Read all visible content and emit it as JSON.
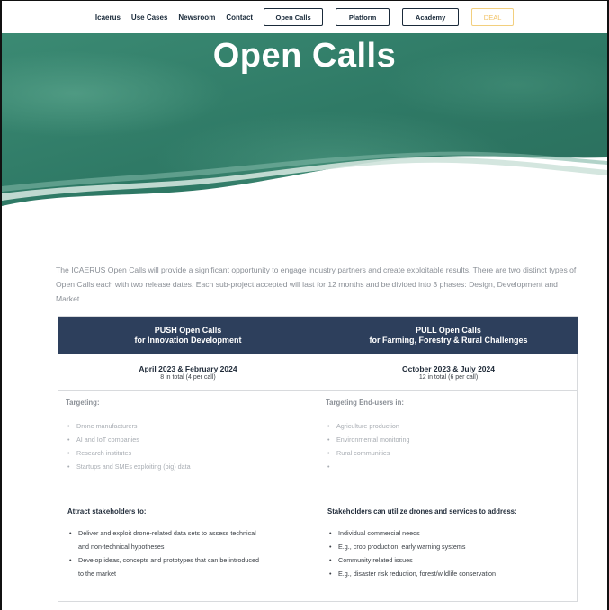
{
  "nav": {
    "links": [
      "Icaerus",
      "Use Cases",
      "Newsroom",
      "Contact"
    ],
    "buttons": {
      "open_calls": "Open Calls",
      "platform": "Platform",
      "academy": "Academy",
      "deal": "DEAL"
    }
  },
  "colors": {
    "hero_teal": "#2f7a66",
    "header_navy": "#2d3f5c",
    "deal_accent": "#f2c265"
  },
  "hero": {
    "title": "Open Calls"
  },
  "intro": {
    "text": "The ICAERUS Open Calls will provide a significant opportunity to engage industry partners and create exploitable results. There are two distinct types of Open Calls each with two release dates. Each sub-project accepted will last for 12 months and be divided into 3 phases: Design, Development and Market."
  },
  "table": {
    "push": {
      "heading_line1": "PUSH Open Calls",
      "heading_line2": "for Innovation Development",
      "dates": "April 2023 & February 2024",
      "dates_sub": "8 in total (4 per call)",
      "targeting_title": "Targeting:",
      "targeting_items": [
        "Drone manufacturers",
        "AI and IoT companies",
        "Research institutes",
        "Startups and SMEs exploiting (big) data"
      ],
      "stake_title": "Attract stakeholders to:",
      "stake_items": [
        "Deliver and exploit drone-related data sets to assess technical and non-technical hypotheses",
        "Develop ideas, concepts and prototypes that can be introduced to the market"
      ]
    },
    "pull": {
      "heading_line1": "PULL Open Calls",
      "heading_line2": "for Farming, Forestry & Rural Challenges",
      "dates": "October 2023 & July 2024",
      "dates_sub": "12 in total (6 per call)",
      "targeting_title": "Targeting End-users in:",
      "targeting_items": [
        "Agriculture production",
        "Environmental monitoring",
        "Rural communities",
        ""
      ],
      "stake_title": "Stakeholders can utilize drones and services to address:",
      "stake_items": [
        "Individual commercial needs",
        "E.g., crop production, early warning systems",
        "Community related issues",
        "E.g., disaster risk reduction, forest/wildlife conservation"
      ]
    }
  }
}
